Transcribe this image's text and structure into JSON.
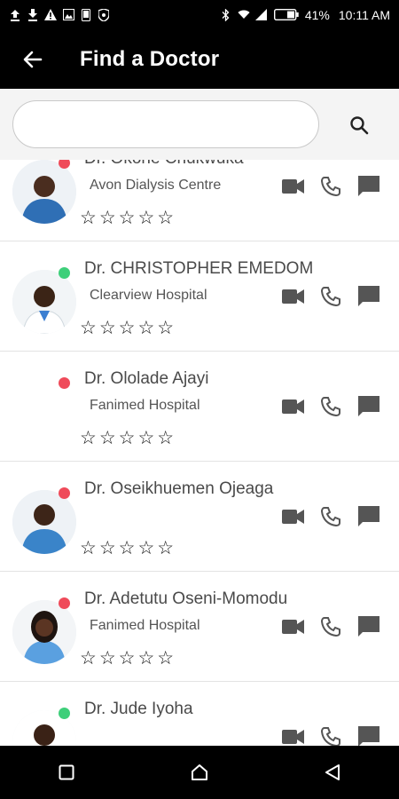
{
  "status_bar": {
    "battery": "41%",
    "time": "10:11 AM",
    "icons": [
      "upload-icon",
      "download-icon",
      "warning-icon",
      "image-icon",
      "phone-icon",
      "shield-icon",
      "bluetooth-icon",
      "wifi-icon",
      "signal-icon",
      "battery-icon"
    ]
  },
  "app_bar": {
    "title": "Find a Doctor",
    "back_icon": "back-arrow-icon"
  },
  "search": {
    "value": "",
    "placeholder": "",
    "icon": "search-icon"
  },
  "stars_text": "☆☆☆☆☆",
  "doctors": [
    {
      "name": "Dr. Okorie Chukwuka",
      "hospital": "Avon Dialysis Centre",
      "status": "offline"
    },
    {
      "name": "Dr. CHRISTOPHER EMEDOM",
      "hospital": "Clearview Hospital",
      "status": "online"
    },
    {
      "name": "Dr. Ololade Ajayi",
      "hospital": "Fanimed Hospital",
      "status": "offline"
    },
    {
      "name": "Dr. Oseikhuemen Ojeaga",
      "hospital": "",
      "status": "offline"
    },
    {
      "name": "Dr. Adetutu Oseni-Momodu",
      "hospital": "Fanimed Hospital",
      "status": "offline"
    },
    {
      "name": "Dr. Jude Iyoha",
      "hospital": "",
      "status": "online"
    }
  ],
  "colors": {
    "online": "#3ecf7a",
    "offline": "#ef4b5a",
    "icon": "#555555",
    "bar": "#000000"
  },
  "nav": [
    "recent-apps-icon",
    "home-icon",
    "back-icon"
  ]
}
